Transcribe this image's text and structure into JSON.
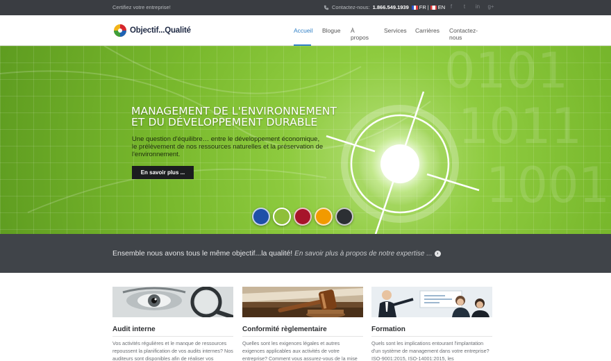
{
  "topbar": {
    "tagline": "Certifiez votre entreprise!",
    "contact_label": "Contactez-nous:",
    "phone": "1.866.549.1939",
    "lang_fr": "FR",
    "lang_sep": "|",
    "lang_en": "EN",
    "social_icons": [
      "facebook-icon",
      "twitter-icon",
      "linkedin-icon",
      "googleplus-icon"
    ]
  },
  "header": {
    "logo_text": "Objectif...Qualité",
    "nav": [
      "Accueil",
      "Blogue",
      "À propos",
      "Services",
      "Carrières",
      "Contactez-nous"
    ],
    "active_nav": "Accueil",
    "accent_color": "#2f7fc6"
  },
  "hero": {
    "title_line1": "MANAGEMENT DE L'ENVIRONNEMENT",
    "title_line2": "ET DU DÉVELOPPEMENT DURABLE",
    "text": "Une question d'équilibre… entre le développement économique, le prélèvement de nos ressources naturelles et la préservation de l'environnement.",
    "button_label": "En savoir plus ...",
    "slider_dots": [
      "#1f4fa8",
      "#8fbf3a",
      "#a7142a",
      "#f29a00",
      "#2c2f33"
    ],
    "active_dot": 1
  },
  "strip": {
    "text": "Ensemble nous avons tous le même objectif...la qualité!",
    "link": "En savoir plus à propos de notre expertise ..."
  },
  "columns": [
    {
      "title": "Audit interne",
      "text": "Vos activités régulières et le manque de ressources repoussent la planification de vos audits internes? Nos auditeurs sont disponibles afin de réaliser vos"
    },
    {
      "title": "Conformité règlementaire",
      "text": "Quelles sont les exigences légales et autres exigences applicables aux activités de votre entreprise? Comment vous assurez-vous de la mise"
    },
    {
      "title": "Formation",
      "text": "Quels sont les implications entourant l'implantation d'un système de management dans votre entreprise? ISO-9001:2015, ISO-14001:2015, les"
    }
  ]
}
